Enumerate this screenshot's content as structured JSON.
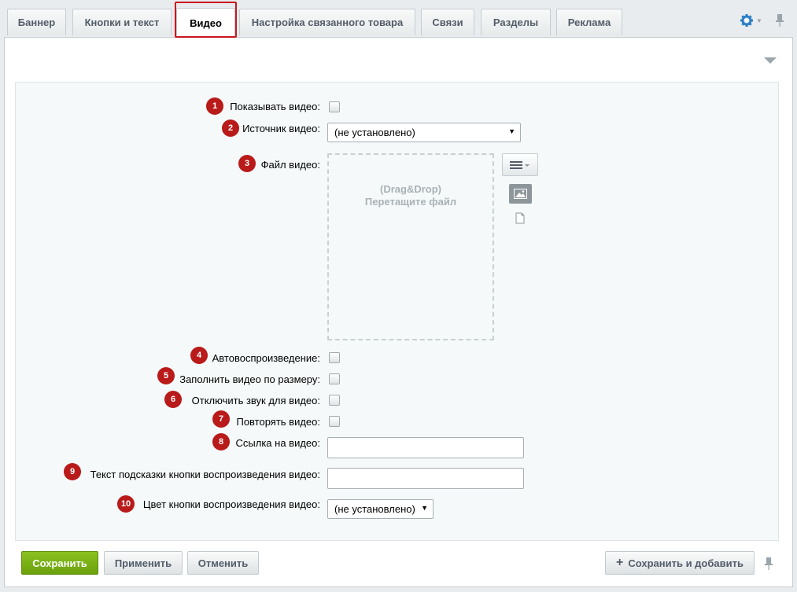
{
  "tabs": [
    {
      "label": "Баннер",
      "active": false
    },
    {
      "label": "Кнопки и текст",
      "active": false
    },
    {
      "label": "Видео",
      "active": true
    },
    {
      "label": "Настройка связанного товара",
      "active": false
    },
    {
      "label": "Связи",
      "active": false
    },
    {
      "label": "Разделы",
      "active": false
    },
    {
      "label": "Реклама",
      "active": false
    }
  ],
  "icons": {
    "settings": "gear-icon",
    "pin": "pin-icon",
    "collapse": "triangle-down-icon"
  },
  "fields": {
    "show_video": {
      "badge": "1",
      "label": "Показывать видео:",
      "checked": false
    },
    "video_source": {
      "badge": "2",
      "label": "Источник видео:",
      "value": "(не установлено)"
    },
    "video_file": {
      "badge": "3",
      "label": "Файл видео:",
      "drop_line1": "(Drag&Drop)",
      "drop_line2": "Перетащите файл"
    },
    "autoplay": {
      "badge": "4",
      "label": "Автовоспроизведение:",
      "checked": false
    },
    "fill_video": {
      "badge": "5",
      "label": "Заполнить видео по размеру:",
      "checked": false
    },
    "mute": {
      "badge": "6",
      "label": "Отключить звук для видео:",
      "checked": false
    },
    "loop": {
      "badge": "7",
      "label": "Повторять видео:",
      "checked": false
    },
    "video_link": {
      "badge": "8",
      "label": "Ссылка на видео:",
      "value": ""
    },
    "play_hint": {
      "badge": "9",
      "label": "Текст подсказки кнопки воспроизведения видео:",
      "value": ""
    },
    "play_color": {
      "badge": "10",
      "label": "Цвет кнопки воспроизведения видео:",
      "value": "(не установлено)"
    }
  },
  "footer": {
    "save": "Сохранить",
    "apply": "Применить",
    "cancel": "Отменить",
    "save_add": "Сохранить и добавить"
  },
  "colors": {
    "accent_red": "#b91a1a",
    "save_green": "#7ab317",
    "link_blue": "#2a7fc5"
  }
}
